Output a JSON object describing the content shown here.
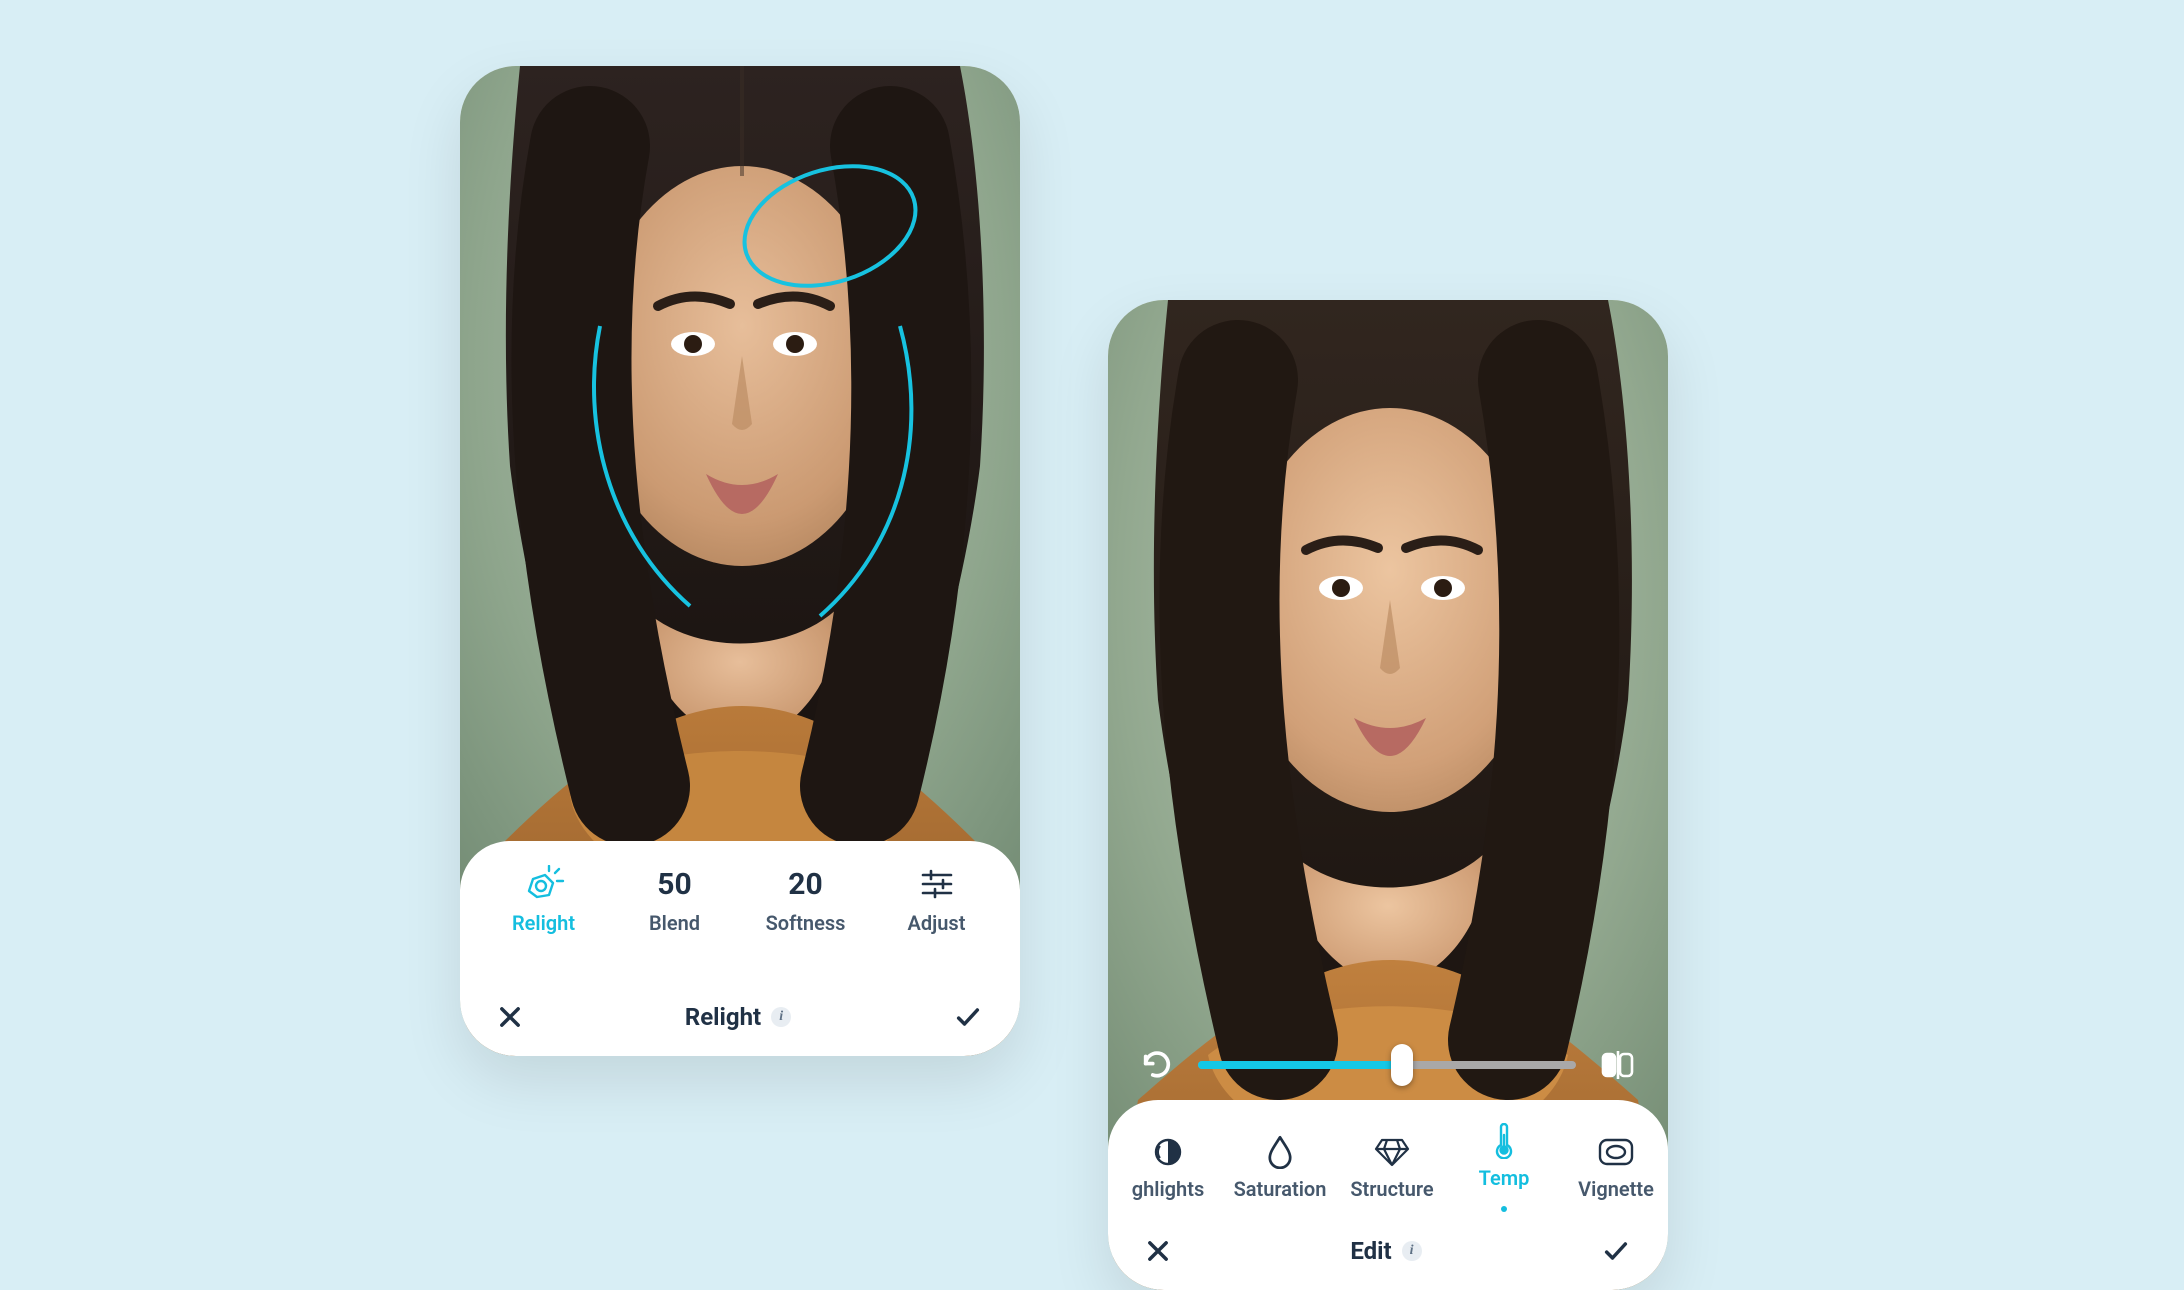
{
  "accent_color": "#14BEDF",
  "text_color": "#203145",
  "phones": {
    "left": {
      "tools": [
        {
          "id": "relight",
          "label": "Relight",
          "icon": "relight-icon",
          "active": true
        },
        {
          "id": "blend",
          "label": "Blend",
          "value": "50",
          "active": false
        },
        {
          "id": "softness",
          "label": "Softness",
          "value": "20",
          "active": false
        },
        {
          "id": "adjust",
          "label": "Adjust",
          "icon": "sliders-icon",
          "active": false
        }
      ],
      "title": "Relight"
    },
    "right": {
      "slider": {
        "percent": 54
      },
      "edits": [
        {
          "id": "highlights",
          "label": "ghlights",
          "icon": "highlights-icon",
          "active": false
        },
        {
          "id": "saturation",
          "label": "Saturation",
          "icon": "drop-icon",
          "active": false
        },
        {
          "id": "structure",
          "label": "Structure",
          "icon": "diamond-icon",
          "active": false
        },
        {
          "id": "temp",
          "label": "Temp",
          "icon": "thermometer-icon",
          "active": true
        },
        {
          "id": "vignette",
          "label": "Vignette",
          "icon": "vignette-icon",
          "active": false
        }
      ],
      "title": "Edit"
    }
  }
}
